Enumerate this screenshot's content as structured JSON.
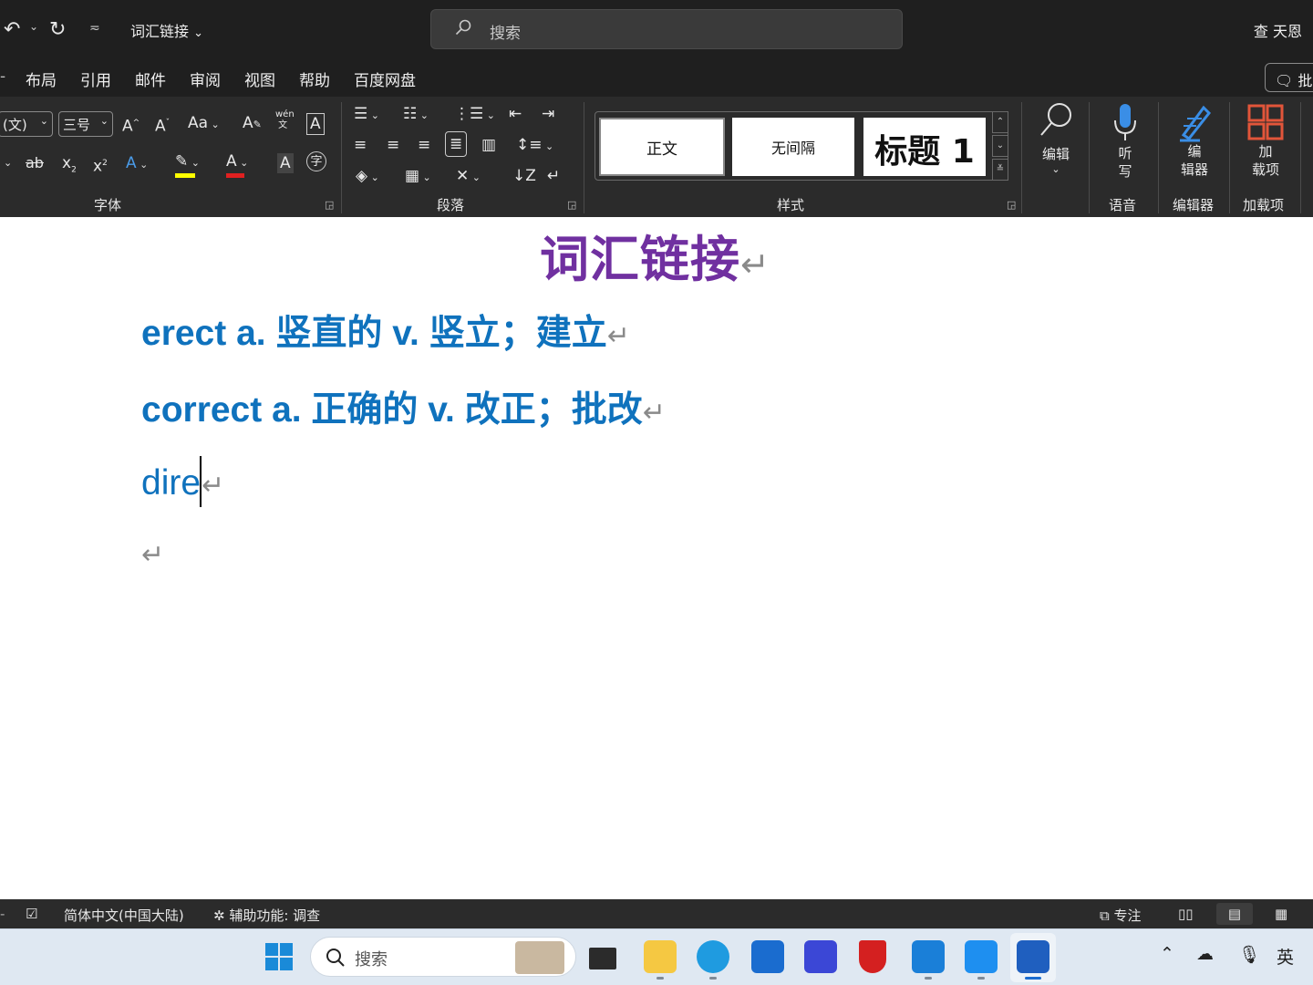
{
  "window": {
    "doc_title": "词汇链接",
    "search_placeholder": "搜索",
    "user_name": "查 天恩"
  },
  "menu": {
    "items": [
      "布局",
      "引用",
      "邮件",
      "审阅",
      "视图",
      "帮助",
      "百度网盘"
    ],
    "comment_label": "批注"
  },
  "ribbon": {
    "font_name": "(文)",
    "font_size": "三号",
    "groups": {
      "font": "字体",
      "paragraph": "段落",
      "styles": "样式",
      "voice": "语音",
      "editor": "编辑器",
      "addins": "加载项"
    },
    "styles": [
      "正文",
      "无间隔",
      "标题 1"
    ],
    "buttons": {
      "edit": "编辑",
      "dictate_1": "听",
      "dictate_2": "写",
      "editor_1": "编",
      "editor_2": "辑器",
      "addins_1": "加",
      "addins_2": "载项"
    }
  },
  "document": {
    "heading": "词汇链接",
    "lines": [
      "erect a. 竖直的 v. 竖立；建立",
      "correct a. 正确的 v. 改正；批改",
      "dire"
    ],
    "paragraph_mark": "↵"
  },
  "statusbar": {
    "language": "简体中文(中国大陆)",
    "accessibility": "辅助功能: 调查",
    "focus": "专注"
  },
  "taskbar": {
    "search_placeholder": "搜索",
    "ime": "英"
  },
  "colors": {
    "heading": "#7030a0",
    "body_text": "#0f72bd",
    "chrome_dark": "#1f1f1f",
    "ribbon": "#2b2b2b",
    "taskbar": "#dfe8f2"
  }
}
